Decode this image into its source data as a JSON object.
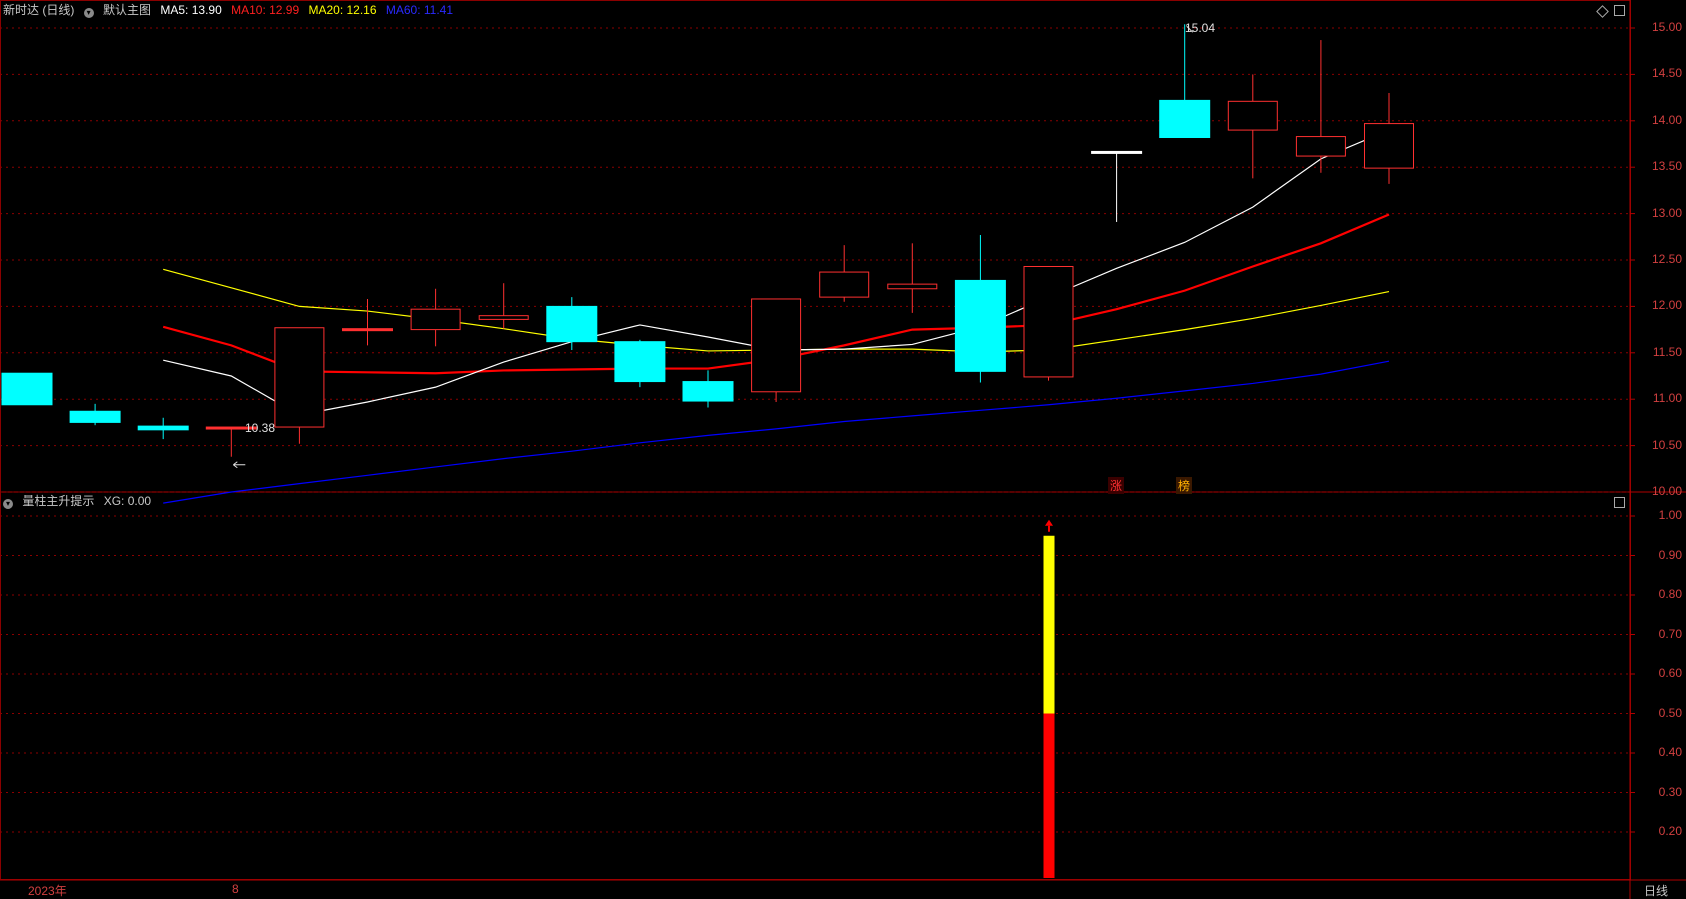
{
  "main_header": {
    "stock": "新时达 (日线)",
    "template": "默认主图",
    "ma5": "MA5: 13.90",
    "ma10": "MA10: 12.99",
    "ma20": "MA20: 12.16",
    "ma60": "MA60: 11.41"
  },
  "sub_header": {
    "indicator": "量柱主升提示",
    "xg": "XG: 0.00"
  },
  "colors": {
    "up": "#ff3030",
    "down": "#00ffff",
    "ma5": "#ffffff",
    "ma10": "#ff0000",
    "ma20": "#ffff00",
    "ma60": "#0000ff",
    "grid": "#8b0000"
  },
  "price_axis": [
    "15.00",
    "14.50",
    "14.00",
    "13.50",
    "13.00",
    "12.50",
    "12.00",
    "11.50",
    "11.00",
    "10.50",
    "10.00"
  ],
  "sub_axis": [
    "1.00",
    "0.90",
    "0.80",
    "0.70",
    "0.60",
    "0.50",
    "0.40",
    "0.30",
    "0.20"
  ],
  "annotations": {
    "high": "15.04",
    "low": "10.38"
  },
  "markers": [
    "涨",
    "榜"
  ],
  "bottom_bar": {
    "year": "2023年",
    "month": "8",
    "period": "日线"
  },
  "icons": {
    "collapse": "chevron-down-icon",
    "main_corner": "diamond-icon",
    "sub_corner": "square-icon"
  },
  "chart_data": {
    "type": "candlestick",
    "candles": [
      {
        "o": 11.28,
        "c": 10.94,
        "h": 11.28,
        "l": 10.94
      },
      {
        "o": 10.87,
        "c": 10.75,
        "h": 10.95,
        "l": 10.72
      },
      {
        "o": 10.71,
        "c": 10.67,
        "h": 10.8,
        "l": 10.57
      },
      {
        "o": 10.69,
        "c": 10.7,
        "h": 10.7,
        "l": 10.38
      },
      {
        "o": 10.7,
        "c": 11.77,
        "h": 11.77,
        "l": 10.52
      },
      {
        "o": 11.76,
        "c": 11.76,
        "h": 12.08,
        "l": 11.58
      },
      {
        "o": 11.75,
        "c": 11.97,
        "h": 12.19,
        "l": 11.57
      },
      {
        "o": 11.86,
        "c": 11.9,
        "h": 12.25,
        "l": 11.76
      },
      {
        "o": 12.0,
        "c": 11.62,
        "h": 12.1,
        "l": 11.53
      },
      {
        "o": 11.62,
        "c": 11.19,
        "h": 11.64,
        "l": 11.13
      },
      {
        "o": 11.19,
        "c": 10.98,
        "h": 11.31,
        "l": 10.91
      },
      {
        "o": 11.08,
        "c": 12.08,
        "h": 12.08,
        "l": 10.97
      },
      {
        "o": 12.1,
        "c": 12.37,
        "h": 12.66,
        "l": 12.05
      },
      {
        "o": 12.19,
        "c": 12.24,
        "h": 12.68,
        "l": 11.93
      },
      {
        "o": 12.28,
        "c": 11.3,
        "h": 12.77,
        "l": 11.18
      },
      {
        "o": 11.24,
        "c": 12.43,
        "h": 12.43,
        "l": 11.2
      },
      {
        "o": 13.67,
        "c": 13.67,
        "h": 13.67,
        "l": 12.91
      },
      {
        "o": 14.22,
        "c": 13.82,
        "h": 15.04,
        "l": 13.82
      },
      {
        "o": 13.9,
        "c": 14.21,
        "h": 14.5,
        "l": 13.38
      },
      {
        "o": 13.62,
        "c": 13.83,
        "h": 14.87,
        "l": 13.44
      },
      {
        "o": 13.49,
        "c": 13.97,
        "h": 14.3,
        "l": 13.32
      }
    ],
    "ma5": [
      null,
      null,
      11.42,
      11.25,
      10.83,
      10.97,
      11.13,
      11.4,
      11.62,
      11.8,
      11.67,
      11.53,
      11.54,
      11.59,
      11.78,
      12.1,
      12.41,
      12.69,
      13.07,
      13.59,
      13.9
    ],
    "ma10": [
      null,
      null,
      11.78,
      11.58,
      11.3,
      11.29,
      11.28,
      11.31,
      11.32,
      11.33,
      11.33,
      11.43,
      11.58,
      11.75,
      11.77,
      11.8,
      11.97,
      12.17,
      12.43,
      12.68,
      12.99
    ],
    "ma20": [
      null,
      null,
      12.4,
      12.2,
      12.0,
      11.95,
      11.86,
      11.76,
      11.65,
      11.58,
      11.52,
      11.53,
      11.54,
      11.54,
      11.51,
      11.53,
      11.64,
      11.75,
      11.87,
      12.01,
      12.16
    ],
    "ma60": [
      null,
      null,
      9.88,
      10.0,
      10.09,
      10.18,
      10.27,
      10.36,
      10.44,
      10.53,
      10.61,
      10.68,
      10.76,
      10.82,
      10.88,
      10.94,
      11.01,
      11.09,
      11.17,
      11.27,
      11.41
    ],
    "price_ylim": [
      9.75,
      15.15
    ],
    "sub_bar": {
      "index": 15,
      "red": 0.5,
      "yellow_top": 0.95
    },
    "sub_ylim": [
      0.0,
      1.08
    ]
  }
}
